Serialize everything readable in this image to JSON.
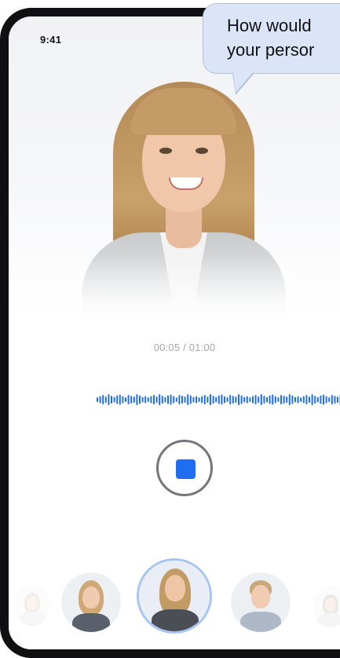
{
  "status_bar": {
    "time": "9:41"
  },
  "speech_bubble": {
    "line1": "How would",
    "line2": "your persor"
  },
  "recording": {
    "timer": "00:05 / 01:00",
    "state": "recording",
    "waveform_color": "#1f6ef2"
  },
  "controls": {
    "stop_button_icon": "stop-icon",
    "accent_color": "#1f6ef2"
  },
  "persona_carousel": {
    "selected_index": 2,
    "selected_ring_color": "#a8c4f0",
    "avatars": [
      {
        "icon": "avatar-woman-faded"
      },
      {
        "icon": "avatar-girl"
      },
      {
        "icon": "avatar-woman-blonde-selected"
      },
      {
        "icon": "avatar-man"
      },
      {
        "icon": "avatar-woman-faded"
      }
    ]
  }
}
